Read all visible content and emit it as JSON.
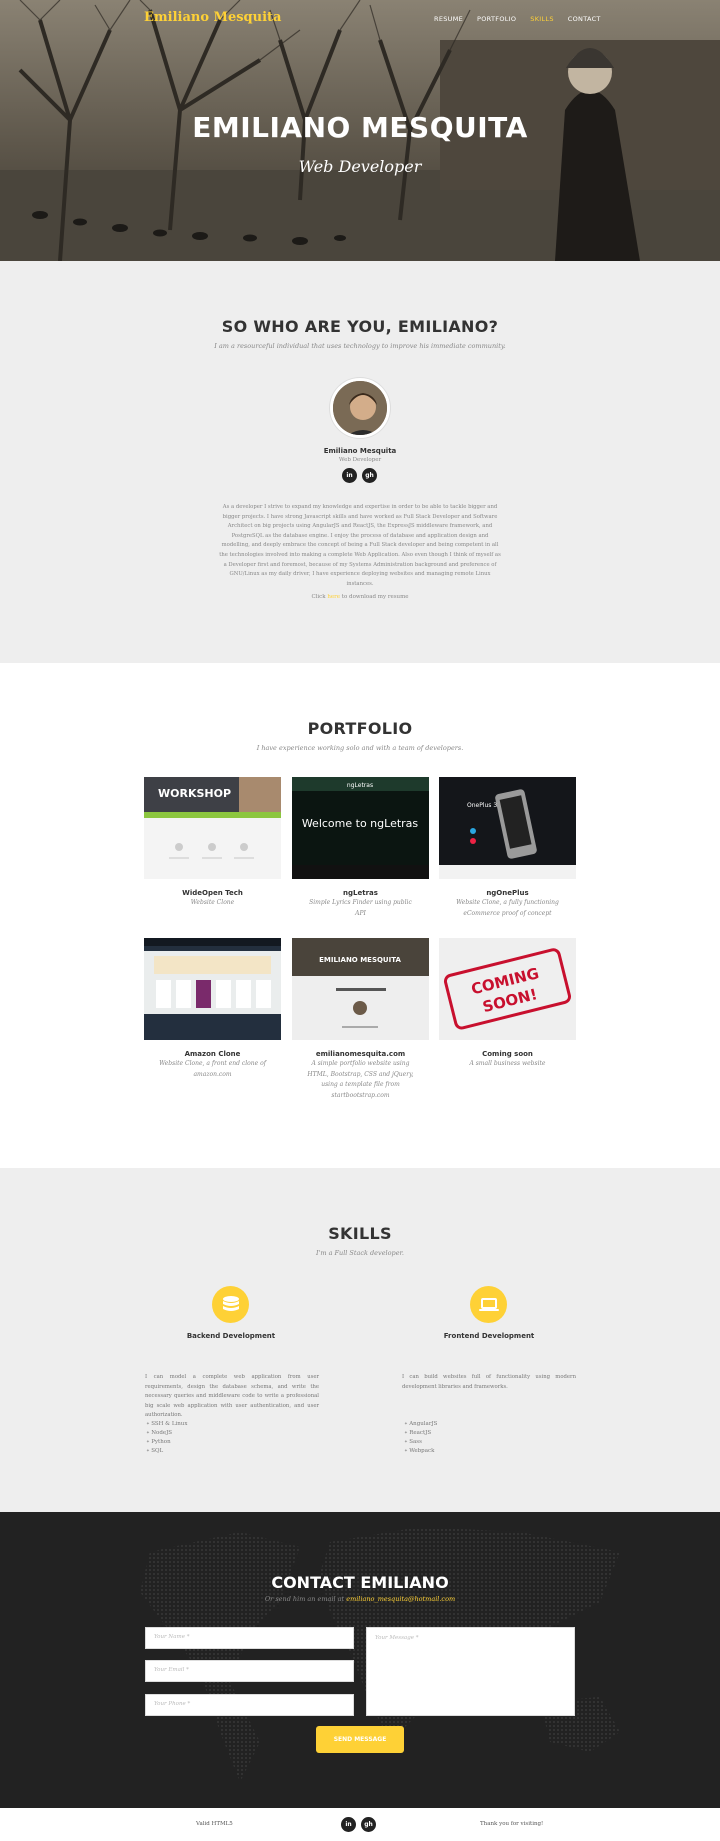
{
  "nav": {
    "brand": "Emiliano Mesquita",
    "links": [
      "RESUME",
      "PORTFOLIO",
      "SKILLS",
      "CONTACT"
    ]
  },
  "hero": {
    "title": "EMILIANO MESQUITA",
    "subtitle": "Web Developer"
  },
  "about": {
    "title": "SO WHO ARE YOU, EMILIANO?",
    "subtitle": "I am a resourceful individual that uses technology to improve his immediate community.",
    "name": "Emiliano Mesquita",
    "role": "Web Developer",
    "social": [
      "in",
      "gh"
    ],
    "bio": "As a developer I strive to expand my knowledge and expertise in order to be able to tackle bigger and bigger projects. I have strong Javascript skills and have worked as Full Stack Developer and Software Architect on big projects using AngularJS and ReactJS, the ExpressJS middleware framework, and PostgreSQL as the database engine. I enjoy the process of database and application design and modelling, and deeply embrace the concept of being a Full Stack developer and being competent in all the technologies involved into making a complete Web Application. Also even though I think of myself as a Developer first and foremost, because of my Systems Administration background and preference of GNU/Linux as my daily driver, I have experience deploying websites and managing remote Linux instances.",
    "resume_prefix": "Click ",
    "resume_link": "here",
    "resume_suffix": " to download my resume"
  },
  "portfolio": {
    "title": "PORTFOLIO",
    "subtitle": "I have experience working solo and with a team of developers.",
    "items": [
      {
        "name": "WideOpen Tech",
        "desc": "Website Clone",
        "thumb_text": "WORKSHOP"
      },
      {
        "name": "ngLetras",
        "desc": "Simple Lyrics Finder using public API",
        "thumb_text": "Welcome to ngLetras"
      },
      {
        "name": "ngOnePlus",
        "desc": "Website Clone, a fully functioning eCommerce proof of concept",
        "thumb_text": "OnePlus 3"
      },
      {
        "name": "Amazon Clone",
        "desc": "Website Clone, a front end clone of amazon.com",
        "thumb_text": ""
      },
      {
        "name": "emilianomesquita.com",
        "desc": "A simple portfolio website using HTML, Bootstrap, CSS and jQuery, using a template file from startbootstrap.com",
        "thumb_text": "EMILIANO MESQUITA"
      },
      {
        "name": "Coming soon",
        "desc": "A small business website",
        "thumb_text": "COMING SOON!"
      }
    ]
  },
  "skills": {
    "title": "SKILLS",
    "subtitle": "I'm a Full Stack developer.",
    "backend": {
      "title": "Backend Development",
      "icon": "database-icon",
      "text": "I can model a complete web application from user requirements, design the database schema, and write the necessary queries and middleware code to write a professional big scale web application with user authentication, and user authorization.",
      "list": [
        "SSH & Linux",
        "NodeJS",
        "Python",
        "SQL"
      ]
    },
    "frontend": {
      "title": "Frontend Development",
      "icon": "laptop-icon",
      "text": "I can build websites full of functionality using modern development libraries and frameworks.",
      "list": [
        "AngularJS",
        "ReactJS",
        "Sass",
        "Webpack"
      ]
    }
  },
  "contact": {
    "title": "CONTACT EMILIANO",
    "subtitle_prefix": "Or send him an email at ",
    "email": "emiliano_mesquita@hotmail.com",
    "placeholders": {
      "name": "Your Name *",
      "email": "Your Email *",
      "phone": "Your Phone *",
      "message": "Your Message *"
    },
    "button": "SEND MESSAGE"
  },
  "footer": {
    "left": "Valid HTML5",
    "right": "Thank you for visiting!",
    "social": [
      "in",
      "gh"
    ]
  },
  "colors": {
    "accent": "#fed136",
    "dark": "#222222",
    "light_bg": "#eeeeee"
  }
}
